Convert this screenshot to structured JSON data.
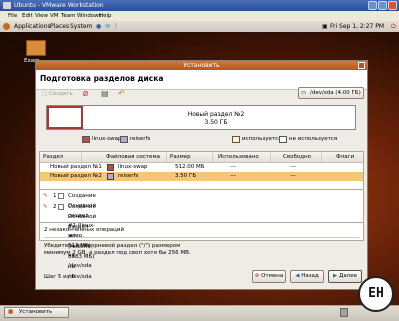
{
  "vmware": {
    "title": "Ubuntu - VMware Workstation",
    "menu": [
      "File",
      "Edit",
      "View",
      "VM",
      "Team",
      "Windows",
      "Help"
    ]
  },
  "panel": {
    "menus": [
      "Applications",
      "Places",
      "System"
    ],
    "datetime": "Fri Sep 1,  2:27 PM"
  },
  "desktop": {
    "icon_label": "Exam"
  },
  "dialog": {
    "window_title": "Установить",
    "heading": "Подготовка разделов диска",
    "toolbar": {
      "new_label": "Создать",
      "device": "/dev/sda (4.00 ГБ)"
    },
    "partition_map": {
      "line1": "Новый раздел №2",
      "line2": "3.50 ГБ"
    },
    "legend": [
      {
        "label": "linux-swap",
        "color": "#b05050"
      },
      {
        "label": "reiserfs",
        "color": "#b6a6d2"
      },
      {
        "label": "используется",
        "color": "#fff4b0"
      },
      {
        "label": "не используется",
        "color": "#ffffff"
      }
    ],
    "table": {
      "headers": [
        "Раздел",
        "Файловая система",
        "Размер",
        "Использовано",
        "Свободно",
        "Флаги"
      ],
      "rows": [
        {
          "partition": "Новый раздел №1",
          "fs": "linux-swap",
          "size": "512.00 МБ",
          "used": "---",
          "free": "---",
          "flags": "",
          "fs_color": "#b05050"
        },
        {
          "partition": "Новый раздел №2",
          "fs": "reiserfs",
          "size": "3.50 ГБ",
          "used": "---",
          "free": "---",
          "flags": "",
          "fs_color": "#b6a6d2"
        }
      ]
    },
    "operations": [
      {
        "num": "1",
        "text": "Создание Основной раздел #1 (linux-swap, 512 МБ) на /dev/sda"
      },
      {
        "num": "2",
        "text": "Создание Основной раздел #2 (reiserfs, 3583 МБ) на /dev/sda"
      }
    ],
    "pending": "2 незаконченных операций",
    "note_line1": "Убедитесь что корневой раздел (\"/\") размером",
    "note_line2": "минимум 2 GB, а раздел под своп хотя бы 256 MB.",
    "step": "Шаг 5 из 6",
    "buttons": {
      "cancel": "Отмена",
      "back": "Назад",
      "forward": "Далее"
    }
  },
  "taskbar": {
    "task": "Установить"
  },
  "watermark": "ЕН"
}
